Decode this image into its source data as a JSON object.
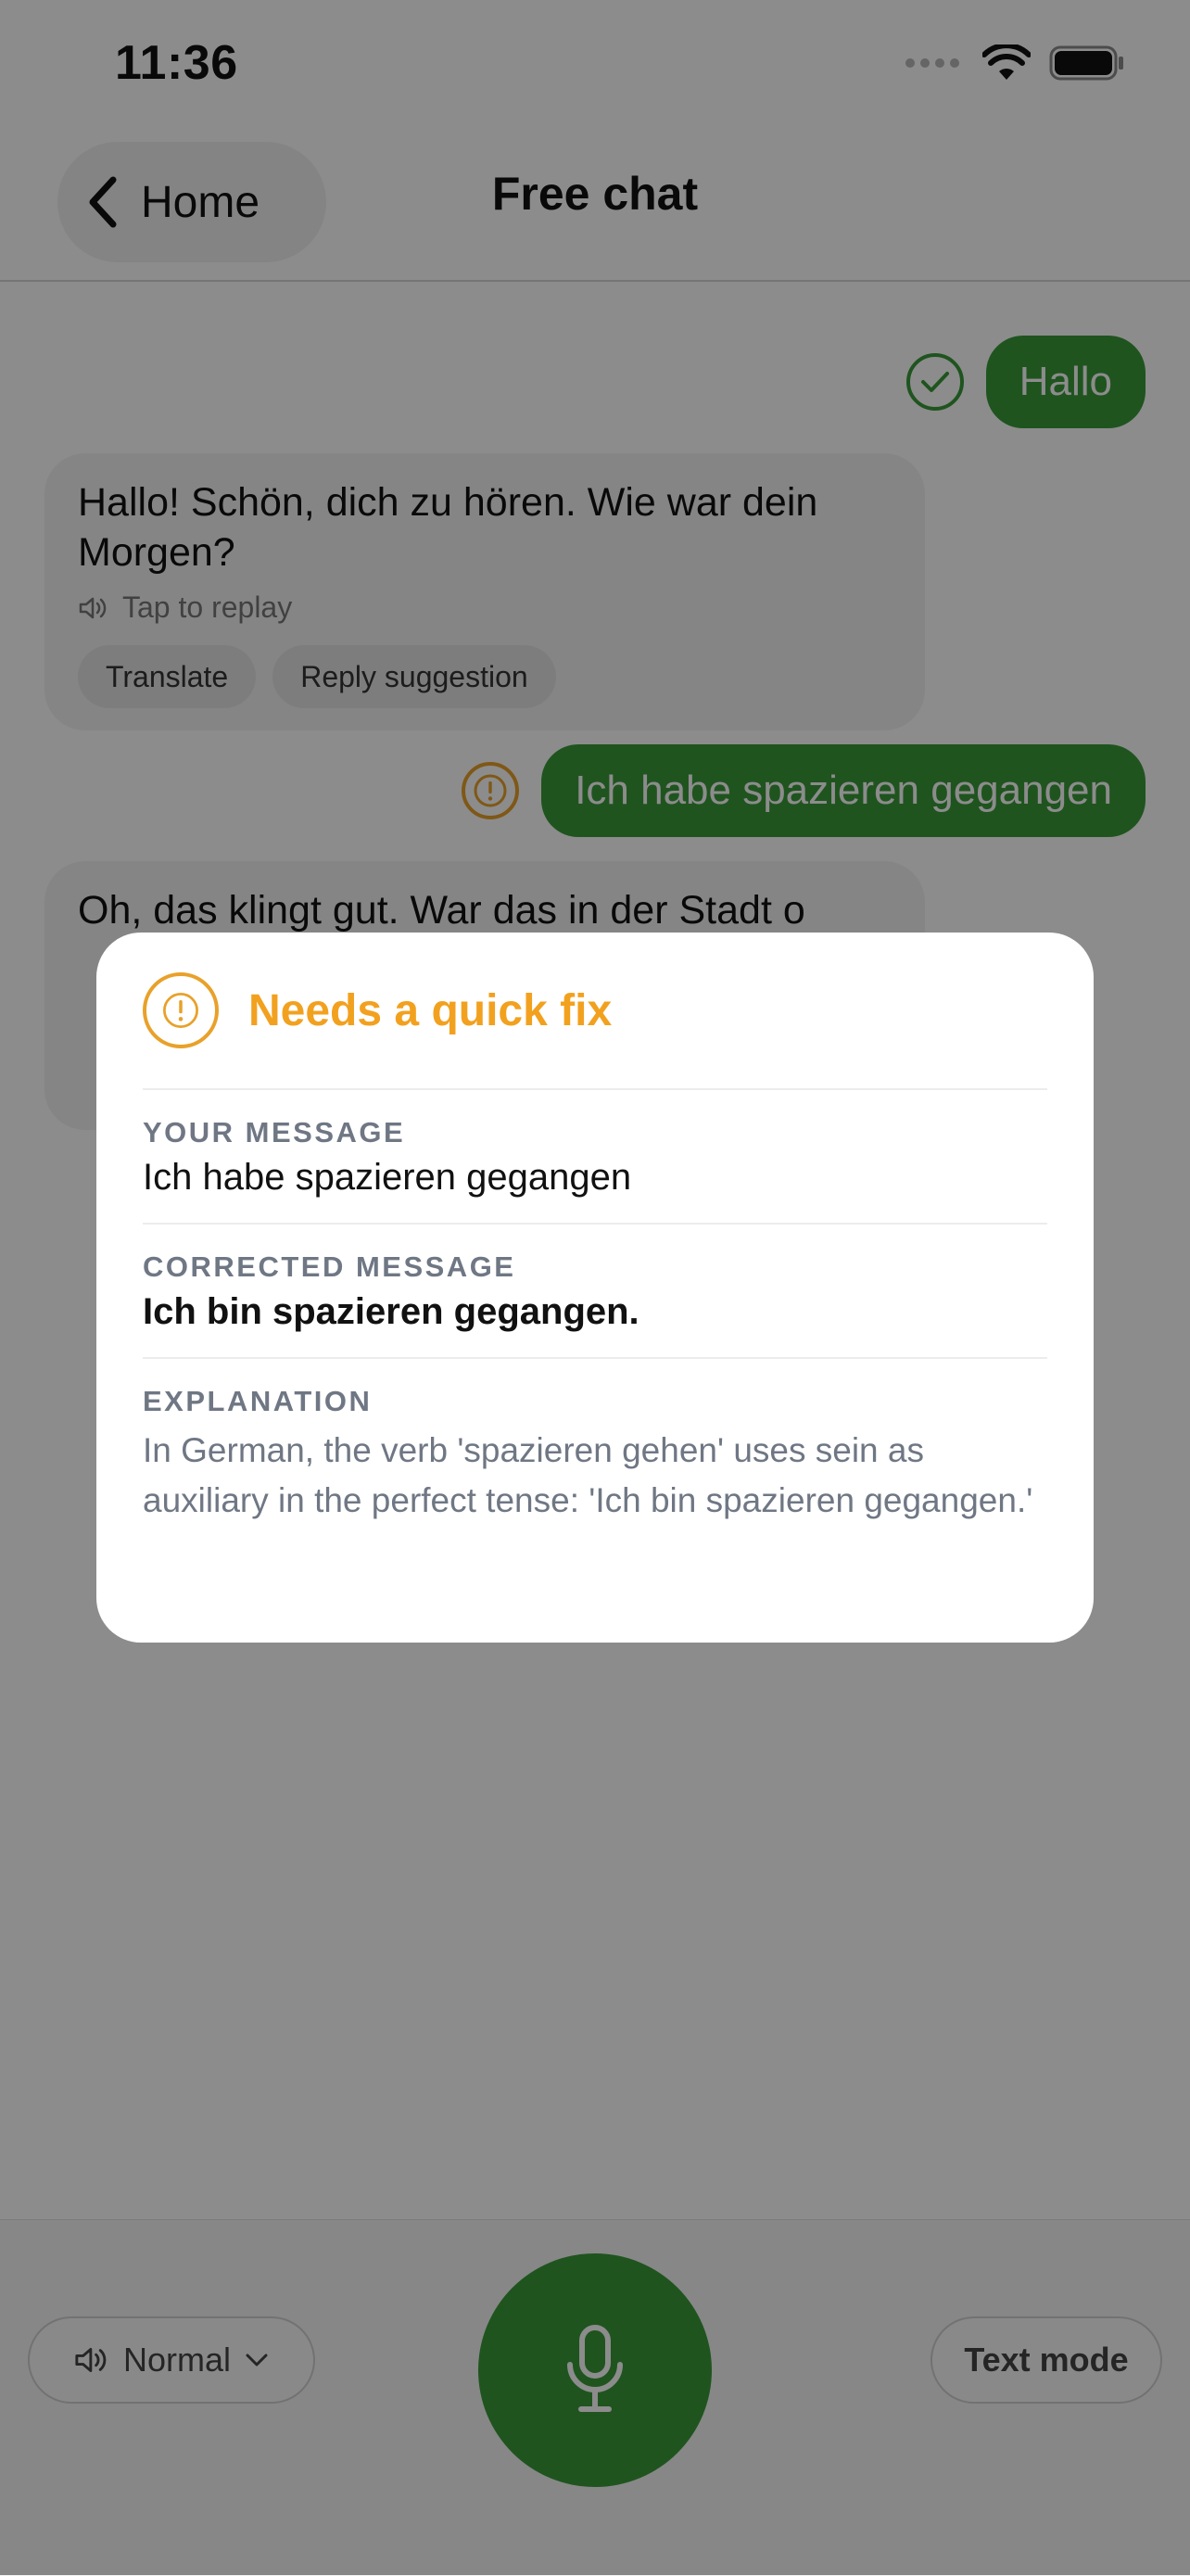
{
  "status_bar": {
    "time": "11:36"
  },
  "nav": {
    "back_label": "Home",
    "title": "Free chat"
  },
  "chat": {
    "messages": [
      {
        "role": "user",
        "text": "Hallo",
        "status": "correct"
      },
      {
        "role": "assistant",
        "text": "Hallo! Schön, dich zu hören. Wie war dein Morgen?",
        "replay_label": "Tap to replay",
        "actions": [
          "Translate",
          "Reply suggestion"
        ]
      },
      {
        "role": "user",
        "text": "Ich habe spazieren gegangen",
        "status": "needs-fix"
      },
      {
        "role": "assistant",
        "text": "Oh, das klingt gut. War das in der Stadt o",
        "replay_label": "",
        "actions": []
      }
    ]
  },
  "modal": {
    "title": "Needs a quick fix",
    "your_message_label": "YOUR MESSAGE",
    "your_message": "Ich habe spazieren gegangen",
    "corrected_label": "CORRECTED MESSAGE",
    "corrected": "Ich bin spazieren gegangen.",
    "explanation_label": "EXPLANATION",
    "explanation": "In German, the verb 'spazieren gehen' uses sein as auxiliary in the perfect tense: 'Ich bin spazieren gegangen.'"
  },
  "bottom_bar": {
    "speed_label": "Normal",
    "text_mode_label": "Text mode"
  },
  "colors": {
    "accent_green": "#3a9a3a",
    "warning_orange": "#f2a11f",
    "overlay": "rgba(0,0,0,0.45)"
  },
  "icons": [
    "chevron-left-icon",
    "signal-icon",
    "wifi-icon",
    "battery-icon",
    "check-icon",
    "exclamation-icon",
    "speaker-icon",
    "chevron-down-icon",
    "microphone-icon"
  ]
}
